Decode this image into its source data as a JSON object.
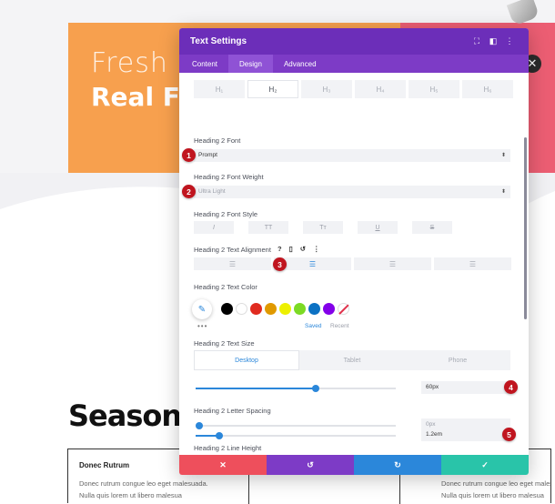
{
  "background": {
    "hero_line1": "Fresh I",
    "hero_line2": "Real Fi",
    "close_glyph": "✕",
    "section_heading": "Seasona",
    "table": {
      "cell_title": "Donec Rutrum",
      "cell_text_line1": "Donec rutrum congue leo eget malesuada.",
      "cell_text_line2": "Nulla quis lorem ut libero malesua",
      "col2_text_line1": "Donec rutrum congue leo eget malesuada.",
      "col2_text_line2": "Nulla quis lorem ut libero malesua"
    },
    "colors": {
      "orange": "#f7a04e",
      "pink": "#ec5e73"
    }
  },
  "modal": {
    "title": "Text Settings",
    "header_icons": [
      "expand-icon",
      "split-icon",
      "more-icon"
    ],
    "tabs": [
      {
        "label": "Content",
        "active": false
      },
      {
        "label": "Design",
        "active": true
      },
      {
        "label": "Advanced",
        "active": false
      }
    ],
    "heading_tabs": [
      {
        "label": "H₁",
        "active": false
      },
      {
        "label": "H₂",
        "active": true
      },
      {
        "label": "H₃",
        "active": false
      },
      {
        "label": "H₄",
        "active": false
      },
      {
        "label": "H₅",
        "active": false
      },
      {
        "label": "H₆",
        "active": false
      }
    ],
    "font": {
      "label": "Heading 2 Font",
      "value": "Prompt"
    },
    "font_weight": {
      "label": "Heading 2 Font Weight",
      "value": "Ultra Light"
    },
    "font_style": {
      "label": "Heading 2 Font Style",
      "buttons": [
        "I",
        "TT",
        "Tт",
        "U",
        "S"
      ]
    },
    "text_alignment": {
      "label": "Heading 2 Text Alignment",
      "help": "?",
      "selected": "center"
    },
    "text_color": {
      "label": "Heading 2 Text Color",
      "swatches": [
        "#000000",
        "#ffffff",
        "#e02b20",
        "#e09900",
        "#edf000",
        "#7cda24",
        "#0c71c3",
        "#8300e9"
      ],
      "saved_label": "Saved",
      "recent_label": "Recent",
      "more": "•••"
    },
    "text_size": {
      "label": "Heading 2 Text Size",
      "devices": [
        {
          "label": "Desktop",
          "active": true
        },
        {
          "label": "Tablet",
          "active": false
        },
        {
          "label": "Phone",
          "active": false
        }
      ],
      "value": "60px",
      "slider_fraction": 0.6
    },
    "letter_spacing": {
      "label": "Heading 2 Letter Spacing",
      "value": "0px",
      "slider_fraction": 0.0
    },
    "line_height": {
      "label": "Heading 2 Line Height",
      "value": "1.2em",
      "slider_fraction": 0.12
    },
    "badges": [
      "1",
      "2",
      "3",
      "4",
      "5"
    ],
    "footer": {
      "cancel": "✕",
      "undo": "↺",
      "redo": "↻",
      "save": "✓"
    },
    "accent": "#6c2eb9"
  }
}
